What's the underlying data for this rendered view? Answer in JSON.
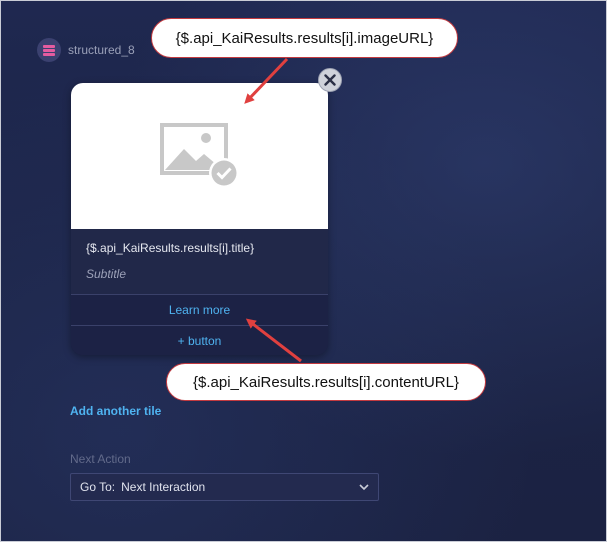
{
  "header": {
    "title": "structured_8",
    "icon": "stack-icon"
  },
  "card": {
    "image_icon": "image-placeholder-icon",
    "title": "{$.api_KaiResults.results[i].title}",
    "subtitle": "Subtitle",
    "button_label": "Learn more",
    "add_button_label": "+ button",
    "close_icon": "close-icon"
  },
  "annotations": {
    "image_url": "{$.api_KaiResults.results[i].imageURL}",
    "content_url": "{$.api_KaiResults.results[i].contentURL}"
  },
  "add_tile_label": "Add another tile",
  "next_action": {
    "label": "Next Action",
    "prefix": "Go To:",
    "value": "Next Interaction"
  },
  "colors": {
    "background": "#1c2446",
    "link": "#4fb3f0",
    "callout_border": "#c33a3f",
    "arrow": "#e0403f",
    "accent_icon": "#e45ca0"
  }
}
